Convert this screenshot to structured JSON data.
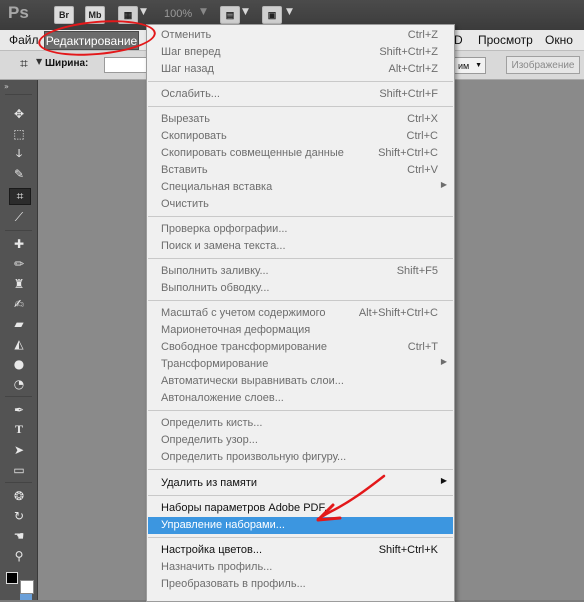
{
  "app": {
    "logo": "Ps",
    "br_label": "Br",
    "mb_label": "Mb",
    "zoom": "100%"
  },
  "menubar": {
    "file": "Файл",
    "edit": "Редактирование",
    "d_tail": "D",
    "view": "Просмотр",
    "window": "Окно"
  },
  "options": {
    "width_label": "Ширина:",
    "image_button": "Изображение",
    "select_tail": "им"
  },
  "menu": {
    "undo": {
      "label": "Отменить",
      "shortcut": "Ctrl+Z"
    },
    "step_forward": {
      "label": "Шаг вперед",
      "shortcut": "Shift+Ctrl+Z"
    },
    "step_back": {
      "label": "Шаг назад",
      "shortcut": "Alt+Ctrl+Z"
    },
    "fade": {
      "label": "Ослабить...",
      "shortcut": "Shift+Ctrl+F"
    },
    "cut": {
      "label": "Вырезать",
      "shortcut": "Ctrl+X"
    },
    "copy": {
      "label": "Скопировать",
      "shortcut": "Ctrl+C"
    },
    "copy_merged": {
      "label": "Скопировать совмещенные данные",
      "shortcut": "Shift+Ctrl+C"
    },
    "paste": {
      "label": "Вставить",
      "shortcut": "Ctrl+V"
    },
    "paste_special": {
      "label": "Специальная вставка"
    },
    "clear": {
      "label": "Очистить"
    },
    "spelling": {
      "label": "Проверка орфографии..."
    },
    "find_replace": {
      "label": "Поиск и замена текста..."
    },
    "fill": {
      "label": "Выполнить заливку...",
      "shortcut": "Shift+F5"
    },
    "stroke": {
      "label": "Выполнить обводку..."
    },
    "content_aware_scale": {
      "label": "Масштаб с учетом содержимого",
      "shortcut": "Alt+Shift+Ctrl+C"
    },
    "puppet_warp": {
      "label": "Марионеточная деформация"
    },
    "free_transform": {
      "label": "Свободное трансформирование",
      "shortcut": "Ctrl+T"
    },
    "transform": {
      "label": "Трансформирование"
    },
    "auto_align": {
      "label": "Автоматически выравнивать слои..."
    },
    "auto_blend": {
      "label": "Автоналожение слоев..."
    },
    "define_brush": {
      "label": "Определить кисть..."
    },
    "define_pattern": {
      "label": "Определить узор..."
    },
    "define_shape": {
      "label": "Определить произвольную фигуру..."
    },
    "purge": {
      "label": "Удалить из памяти"
    },
    "pdf_presets": {
      "label": "Наборы параметров Adobe PDF..."
    },
    "preset_manager": {
      "label": "Управление наборами..."
    },
    "color_settings": {
      "label": "Настройка цветов...",
      "shortcut": "Shift+Ctrl+K"
    },
    "assign_profile": {
      "label": "Назначить профиль..."
    },
    "convert_profile": {
      "label": "Преобразовать в профиль..."
    }
  },
  "colors": {
    "annotation": "#e3181a",
    "highlight": "#3c96e0"
  }
}
